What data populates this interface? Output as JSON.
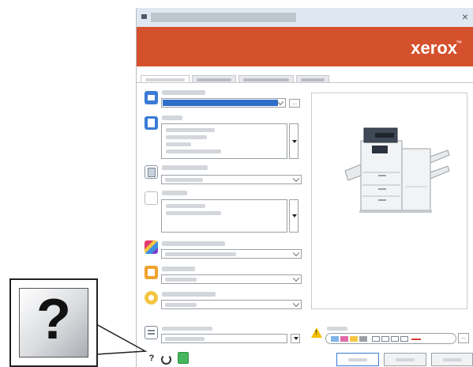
{
  "window": {
    "title": "",
    "close_glyph": "×"
  },
  "brand": {
    "logo_text": "xerox",
    "trademark": "™",
    "bar_color": "#d5512d"
  },
  "tabs": [
    {
      "label": ""
    },
    {
      "label": ""
    },
    {
      "label": ""
    },
    {
      "label": ""
    }
  ],
  "settings": [
    {
      "icon": "printer-icon",
      "label": "",
      "value": ""
    },
    {
      "icon": "paper-icon",
      "label": "",
      "value": ""
    },
    {
      "icon": "duplex-icon",
      "label": "",
      "value": ""
    },
    {
      "icon": "finishing-icon",
      "label": "",
      "value": ""
    },
    {
      "icon": "color-icon",
      "label": "",
      "value": ""
    },
    {
      "icon": "job-type-icon",
      "label": "",
      "value": ""
    },
    {
      "icon": "saved-settings-icon",
      "label": "",
      "value": ""
    },
    {
      "icon": "presets-icon",
      "label": "",
      "value": ""
    }
  ],
  "help": {
    "glyph": "?",
    "callout_glyph": "?"
  },
  "status": {
    "warning_glyph": "!"
  },
  "footer": {
    "more_glyph": "...",
    "ellipsis_glyph": "...",
    "ok_label": "",
    "cancel_label": "",
    "apply_label": ""
  }
}
